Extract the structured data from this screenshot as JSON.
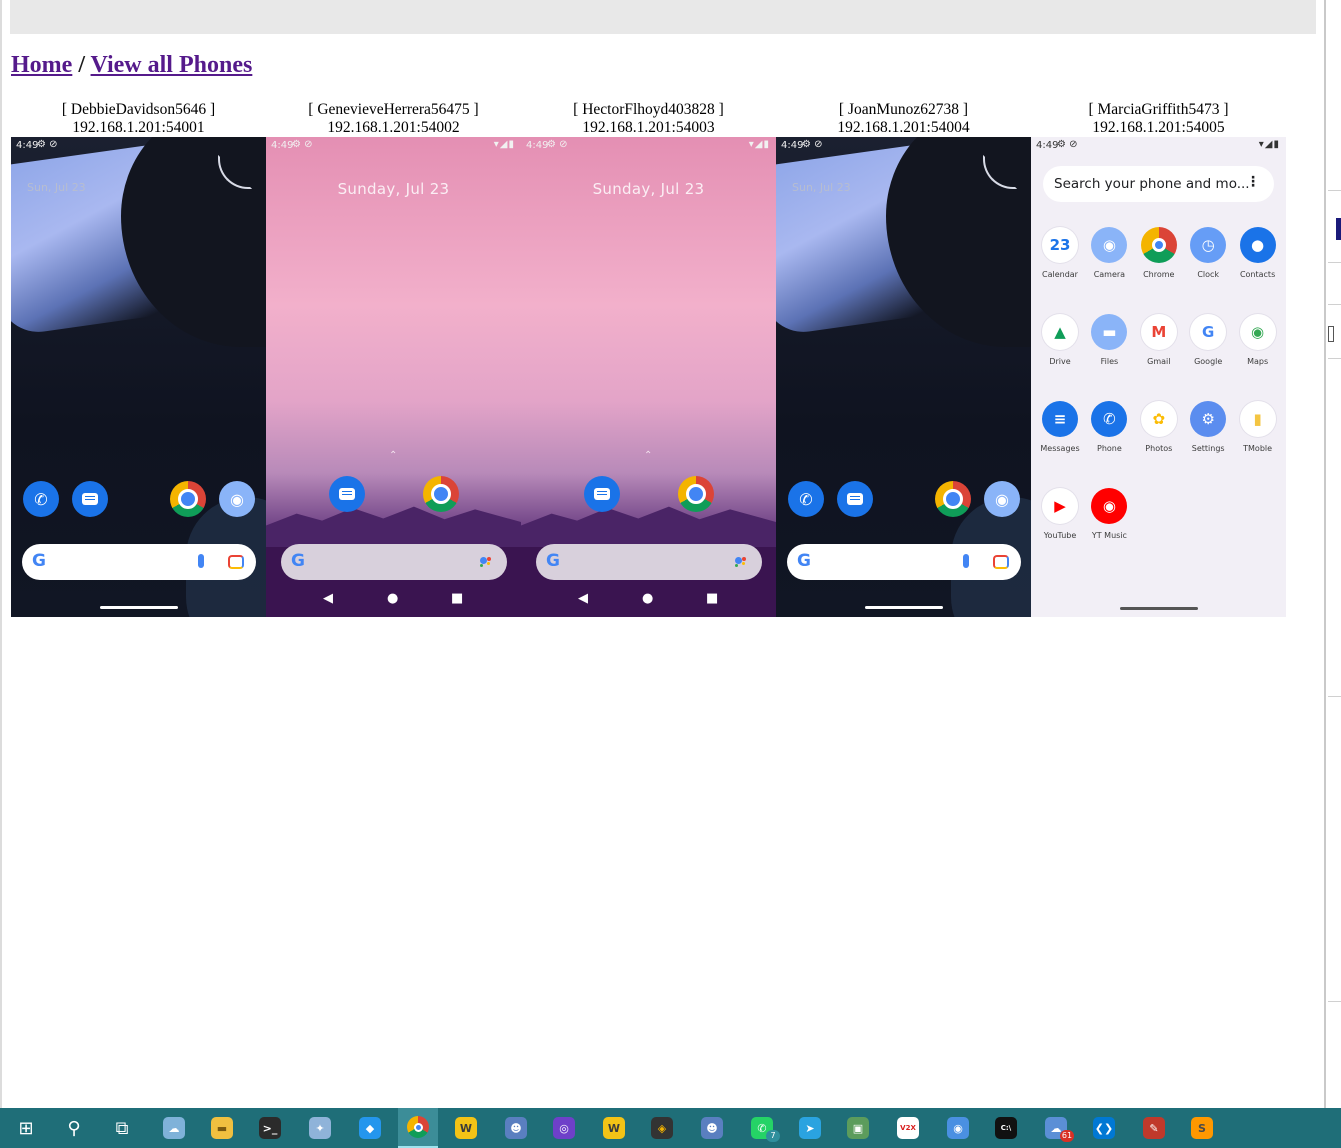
{
  "breadcrumb": {
    "home": "Home",
    "separator": " / ",
    "current": "View all Phones"
  },
  "phones": [
    {
      "name": "[ DebbieDavidson5646 ]",
      "address": "192.168.1.201:54001",
      "screen": "lock-dark",
      "time": "4:49",
      "date": "Sun, Jul 23"
    },
    {
      "name": "[ GenevieveHerrera56475 ]",
      "address": "192.168.1.201:54002",
      "screen": "lock-pink",
      "time": "4:49",
      "date": "Sunday, Jul 23"
    },
    {
      "name": "[ HectorFlhoyd403828 ]",
      "address": "192.168.1.201:54003",
      "screen": "lock-pink",
      "time": "4:49",
      "date": "Sunday, Jul 23"
    },
    {
      "name": "[ JoanMunoz62738 ]",
      "address": "192.168.1.201:54004",
      "screen": "lock-dark",
      "time": "4:49",
      "date": "Sun, Jul 23"
    },
    {
      "name": "[ MarciaGriffith5473 ]",
      "address": "192.168.1.201:54005",
      "screen": "app-drawer",
      "time": "4:49",
      "search_placeholder": "Search your phone and mo...",
      "apps": [
        {
          "label": "Calendar",
          "icon": "calendar-icon",
          "color": "#ffffff",
          "glyph": "23",
          "fg": "#1a73e8"
        },
        {
          "label": "Camera",
          "icon": "camera-icon",
          "color": "#8ab4f8",
          "glyph": "◉",
          "fg": "#ffffff"
        },
        {
          "label": "Chrome",
          "icon": "chrome-icon",
          "color": "chrome",
          "glyph": "",
          "fg": "#ffffff"
        },
        {
          "label": "Clock",
          "icon": "clock-icon",
          "color": "#669df6",
          "glyph": "◷",
          "fg": "#ffffff"
        },
        {
          "label": "Contacts",
          "icon": "contacts-icon",
          "color": "#1a73e8",
          "glyph": "●",
          "fg": "#ffffff"
        },
        {
          "label": "Drive",
          "icon": "drive-icon",
          "color": "#ffffff",
          "glyph": "▲",
          "fg": "#0f9d58"
        },
        {
          "label": "Files",
          "icon": "files-icon",
          "color": "#8ab4f8",
          "glyph": "▬",
          "fg": "#ffffff"
        },
        {
          "label": "Gmail",
          "icon": "gmail-icon",
          "color": "#ffffff",
          "glyph": "M",
          "fg": "#ea4335"
        },
        {
          "label": "Google",
          "icon": "google-icon",
          "color": "#ffffff",
          "glyph": "G",
          "fg": "#4285f4"
        },
        {
          "label": "Maps",
          "icon": "maps-icon",
          "color": "#ffffff",
          "glyph": "◉",
          "fg": "#34a853"
        },
        {
          "label": "Messages",
          "icon": "messages-icon",
          "color": "#1a73e8",
          "glyph": "≡",
          "fg": "#ffffff"
        },
        {
          "label": "Phone",
          "icon": "phone-icon",
          "color": "#1a73e8",
          "glyph": "✆",
          "fg": "#ffffff"
        },
        {
          "label": "Photos",
          "icon": "photos-icon",
          "color": "#ffffff",
          "glyph": "✿",
          "fg": "#fbbc05"
        },
        {
          "label": "Settings",
          "icon": "settings-icon",
          "color": "#5b8def",
          "glyph": "⚙",
          "fg": "#ffffff"
        },
        {
          "label": "TMoble",
          "icon": "sim-card-icon",
          "color": "#ffffff",
          "glyph": "▮",
          "fg": "#f4c542"
        },
        {
          "label": "YouTube",
          "icon": "youtube-icon",
          "color": "#ffffff",
          "glyph": "▶",
          "fg": "#ff0000"
        },
        {
          "label": "YT Music",
          "icon": "yt-music-icon",
          "color": "#ff0000",
          "glyph": "◉",
          "fg": "#ffffff"
        }
      ]
    }
  ],
  "taskbar": {
    "items": [
      {
        "icon": "windows-start-icon",
        "glyph": "⊞",
        "bg": "",
        "fg": "#ffffff"
      },
      {
        "icon": "search-icon",
        "glyph": "⚲",
        "bg": "",
        "fg": "#ffffff"
      },
      {
        "icon": "task-view-icon",
        "glyph": "⧉",
        "bg": "",
        "fg": "#ffffff"
      },
      {
        "icon": "weather-app-icon",
        "glyph": "☁",
        "bg": "#7fb2d9",
        "fg": "#ffffff"
      },
      {
        "icon": "file-explorer-icon",
        "glyph": "▬",
        "bg": "#f0c040",
        "fg": "#7a5a10"
      },
      {
        "icon": "terminal-icon",
        "glyph": ">_",
        "bg": "#2b2b2b",
        "fg": "#ffffff"
      },
      {
        "icon": "network-app-icon",
        "glyph": "✦",
        "bg": "#8fb3d9",
        "fg": "#ffffff"
      },
      {
        "icon": "docker-icon",
        "glyph": "◆",
        "bg": "#2496ed",
        "fg": "#ffffff"
      },
      {
        "icon": "chrome-icon",
        "glyph": "◉",
        "bg": "chrome",
        "fg": "#ffffff",
        "active": true
      },
      {
        "icon": "wamp-icon",
        "glyph": "W",
        "bg": "#f3c316",
        "fg": "#3b3b3b"
      },
      {
        "icon": "robot-app-icon",
        "glyph": "☻",
        "bg": "#5a7fc0",
        "fg": "#ffffff"
      },
      {
        "icon": "github-icon",
        "glyph": "◎",
        "bg": "#6e40c9",
        "fg": "#ffffff"
      },
      {
        "icon": "wamp-2-icon",
        "glyph": "W",
        "bg": "#f3c316",
        "fg": "#3b3b3b"
      },
      {
        "icon": "davinci-icon",
        "glyph": "◈",
        "bg": "#333333",
        "fg": "#f4b400"
      },
      {
        "icon": "robot-app-2-icon",
        "glyph": "☻",
        "bg": "#5a7fc0",
        "fg": "#ffffff"
      },
      {
        "icon": "whatsapp-icon",
        "glyph": "✆",
        "bg": "#25d366",
        "fg": "#ffffff",
        "badge": "7",
        "badge_color": "#2f8f9d"
      },
      {
        "icon": "telegram-icon",
        "glyph": "➤",
        "bg": "#2aa3e0",
        "fg": "#ffffff"
      },
      {
        "icon": "photo-viewer-icon",
        "glyph": "▣",
        "bg": "#5c9c5c",
        "fg": "#ffffff"
      },
      {
        "icon": "v2x-icon",
        "glyph": "V2X",
        "bg": "#ffffff",
        "fg": "#d81b1b"
      },
      {
        "icon": "chromium-icon",
        "glyph": "◉",
        "bg": "#4a90e2",
        "fg": "#ffffff"
      },
      {
        "icon": "cmd-icon",
        "glyph": "C:\\",
        "bg": "#111111",
        "fg": "#ffffff"
      },
      {
        "icon": "mail-app-icon",
        "glyph": "☁",
        "bg": "#5b8fd6",
        "fg": "#ffffff",
        "badge": "61",
        "badge_color": "#d93025"
      },
      {
        "icon": "vscode-icon",
        "glyph": "❮❯",
        "bg": "#0078d4",
        "fg": "#ffffff"
      },
      {
        "icon": "paint-app-icon",
        "glyph": "✎",
        "bg": "#c0392b",
        "fg": "#ffffff"
      },
      {
        "icon": "sublime-text-icon",
        "glyph": "S",
        "bg": "#ff9800",
        "fg": "#4a4a4a"
      }
    ]
  }
}
